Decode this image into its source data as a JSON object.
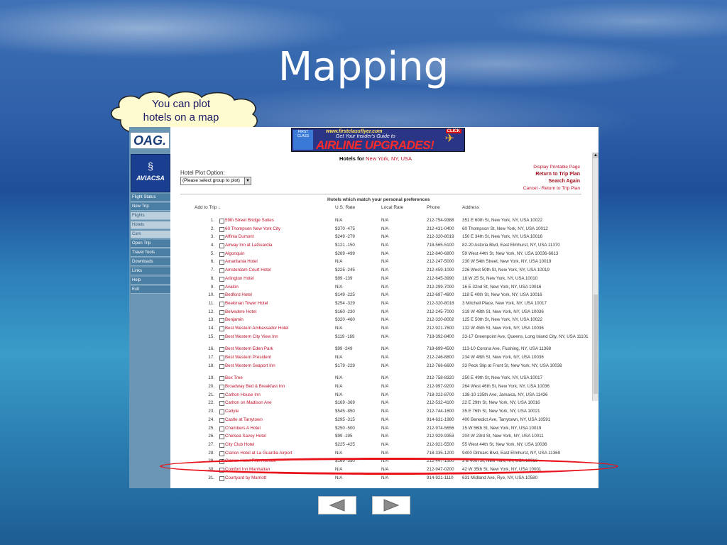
{
  "slide": {
    "title": "Mapping",
    "callout_line1": "You can plot",
    "callout_line2": "hotels on a map"
  },
  "app": {
    "logo_oag": "OAG.",
    "logo_avianca": "AVIACSA",
    "nav_items": [
      "Flight Status",
      "New Trip",
      "Flights",
      "Hotels",
      "Cars",
      "Open Trip",
      "Travel Tools",
      "Downloads",
      "Links",
      "Help",
      "Exit"
    ],
    "banner": {
      "top": "www.firstclassflyer.com",
      "mid": "Get Your Insider's Guide to",
      "main": "AIRLINE UPGRADES!",
      "click": "CLICK",
      "first_class": "FIRST CLASS"
    },
    "hotels_for_label": "Hotels for",
    "city": "New York, NY, USA",
    "links": {
      "printable": "Display Printable Page",
      "return": "Return to Trip Plan",
      "search_again": "Search Again",
      "cancel": "Cancel - Return to Trip Plan"
    },
    "plot_option_label": "Hotel Plot Option:",
    "plot_select_value": "(Please select group to plot)",
    "table_title": "Hotels which match your personal preferences",
    "columns": {
      "add": "Add to Trip ↓",
      "rate": "U.S. Rate",
      "local": "Local Rate",
      "phone": "Phone",
      "address": "Address"
    },
    "hotels": [
      {
        "n": "1.",
        "name": "59th Street Bridge Suites",
        "rate": "N/A",
        "local": "N/A",
        "phone": "212-754-9388",
        "addr": "351 E 60th St, New York, NY, USA 10022",
        "checked": false
      },
      {
        "n": "2.",
        "name": "60 Thompson New York City",
        "rate": "$370 -475",
        "local": "N/A",
        "phone": "212-431-0400",
        "addr": "60 Thompson St, New York, NY, USA 10012",
        "checked": false
      },
      {
        "n": "3.",
        "name": "Affinia Dumont",
        "rate": "$249 -279",
        "local": "N/A",
        "phone": "212-320-8019",
        "addr": "150 E 34th St, New York, NY, USA 10016",
        "checked": false
      },
      {
        "n": "4.",
        "name": "Airway Inn at LaGuardia",
        "rate": "$121 -150",
        "local": "N/A",
        "phone": "718-565-5100",
        "addr": "82-20 Astoria Blvd, East Elmhurst, NY, USA 11370",
        "checked": false
      },
      {
        "n": "5.",
        "name": "Algonquin",
        "rate": "$269 -499",
        "local": "N/A",
        "phone": "212-840-6800",
        "addr": "59 West 44th St, New York, NY, USA 10036-6613",
        "checked": false
      },
      {
        "n": "6.",
        "name": "Amaritania Hotel",
        "rate": "N/A",
        "local": "N/A",
        "phone": "212-247-5000",
        "addr": "230 W 54th Street, New York, NY, USA 10019",
        "checked": false
      },
      {
        "n": "7.",
        "name": "Amsterdam Court Hotel",
        "rate": "$225 -245",
        "local": "N/A",
        "phone": "212-459-1000",
        "addr": "226 West 50th St, New York, NY, USA 10019",
        "checked": false
      },
      {
        "n": "8.",
        "name": "Arlington Hotel",
        "rate": "$99 -139",
        "local": "N/A",
        "phone": "212-645-3990",
        "addr": "18 W 25 St, New York, NY, USA 10010",
        "checked": false
      },
      {
        "n": "9.",
        "name": "Avalon",
        "rate": "N/A",
        "local": "N/A",
        "phone": "212-299-7000",
        "addr": "16 E 32nd St, New York, NY, USA 10016",
        "checked": false
      },
      {
        "n": "10.",
        "name": "Bedford Hotel",
        "rate": "$149 -225",
        "local": "N/A",
        "phone": "212-697-4800",
        "addr": "118 E 40th St, New York, NY, USA 10016",
        "checked": false
      },
      {
        "n": "11.",
        "name": "Beekman Tower Hotel",
        "rate": "$254 -329",
        "local": "N/A",
        "phone": "212-320-8018",
        "addr": "3 Mitchell Place, New York, NY, USA 10017",
        "checked": false
      },
      {
        "n": "12.",
        "name": "Belvedere Hotel",
        "rate": "$160 -230",
        "local": "N/A",
        "phone": "212-245-7000",
        "addr": "319 W 48th St, New York, NY, USA 10036",
        "checked": false
      },
      {
        "n": "13.",
        "name": "Benjamin",
        "rate": "$320 -460",
        "local": "N/A",
        "phone": "212-320-8002",
        "addr": "125 E 50th St, New York, NY, USA 10022",
        "checked": false
      },
      {
        "n": "14.",
        "name": "Best Western Ambassador Hotel",
        "rate": "N/A",
        "local": "N/A",
        "phone": "212-921-7600",
        "addr": "132 W 45th St, New York, NY, USA 10036",
        "checked": false
      },
      {
        "n": "15.",
        "name": "Best Western City View Inn",
        "rate": "$119 -169",
        "local": "N/A",
        "phone": "718-392-8400",
        "addr": "33-17 Greenpoint Ave, Queens, Long Island City, NY, USA 11101",
        "checked": false,
        "tall": true
      },
      {
        "n": "16.",
        "name": "Best Western Eden Park",
        "rate": "$99 -249",
        "local": "N/A",
        "phone": "718-699-4500",
        "addr": "113-10 Corona Ave, Flushing, NY, USA 11368",
        "checked": false
      },
      {
        "n": "17.",
        "name": "Best Western President",
        "rate": "N/A",
        "local": "N/A",
        "phone": "212-246-8800",
        "addr": "234 W 48th St, New York, NY, USA 10036",
        "checked": false
      },
      {
        "n": "18.",
        "name": "Best Western Seaport Inn",
        "rate": "$179 -229",
        "local": "N/A",
        "phone": "212-766-6600",
        "addr": "33 Peck Slip at Front St, New York, NY, USA 10038",
        "checked": false,
        "tall": true
      },
      {
        "n": "19.",
        "name": "Box Tree",
        "rate": "N/A",
        "local": "N/A",
        "phone": "212-758-8320",
        "addr": "250 E 49th St, New York, NY, USA 10017",
        "checked": false
      },
      {
        "n": "20.",
        "name": "Broadway Bed & Breakfast Inn",
        "rate": "N/A",
        "local": "N/A",
        "phone": "212-997-9200",
        "addr": "264 West 46th St, New York, NY, USA 10036",
        "checked": false
      },
      {
        "n": "21.",
        "name": "Carlton House Inn",
        "rate": "N/A",
        "local": "N/A",
        "phone": "718-322-8700",
        "addr": "138-10 135th Ave, Jamaica, NY, USA 11436",
        "checked": false
      },
      {
        "n": "22.",
        "name": "Carlton on Madison Ave",
        "rate": "$169 -369",
        "local": "N/A",
        "phone": "212-532-4100",
        "addr": "22 E 29th St, New York, NY, USA 10016",
        "checked": false
      },
      {
        "n": "23.",
        "name": "Carlyle",
        "rate": "$545 -850",
        "local": "N/A",
        "phone": "212-744-1600",
        "addr": "35 E 76th St, New York, NY, USA 10021",
        "checked": false
      },
      {
        "n": "24.",
        "name": "Castle at Tarrytown",
        "rate": "$295 -315",
        "local": "N/A",
        "phone": "914-631-1980",
        "addr": "400 Benedict Ave, Tarrytown, NY, USA 10591",
        "checked": false
      },
      {
        "n": "25.",
        "name": "Chambers A Hotel",
        "rate": "$250 -500",
        "local": "N/A",
        "phone": "212-974-5656",
        "addr": "15 W 56th St, New York, NY, USA 10019",
        "checked": false
      },
      {
        "n": "26.",
        "name": "Chelsea Savoy Hotel",
        "rate": "$99 -195",
        "local": "N/A",
        "phone": "212-929-9353",
        "addr": "204 W 23rd St, New York, NY, USA 10011",
        "checked": false
      },
      {
        "n": "27.",
        "name": "City Club Hotel",
        "rate": "$225 -425",
        "local": "N/A",
        "phone": "212-921-5500",
        "addr": "55 West 44th St, New York, NY, USA 10036",
        "checked": false
      },
      {
        "n": "28.",
        "name": "Clarion Hotel at La Guardia Airport",
        "rate": "N/A",
        "local": "N/A",
        "phone": "718-335-1200",
        "addr": "9400 Ditmars Blvd, East Elmhurst, NY, USA 11369",
        "checked": false
      },
      {
        "n": "29.",
        "name": "Clarion Hotel Fifth Avenue",
        "rate": "$169 -350",
        "local": "N/A",
        "phone": "212-447-1500",
        "addr": "3 E 40th St, New York, NY, USA 10016",
        "checked": true
      },
      {
        "n": "30.",
        "name": "Comfort Inn Manhattan",
        "rate": "N/A",
        "local": "N/A",
        "phone": "212-947-0200",
        "addr": "42 W 35th St, New York, NY, USA 10001",
        "checked": false
      },
      {
        "n": "31.",
        "name": "Courtyard by Marriott",
        "rate": "N/A",
        "local": "N/A",
        "phone": "914-921-1110",
        "addr": "631 Midland Ave, Rye, NY, USA 10580",
        "checked": false
      }
    ]
  },
  "nav": {
    "prev_icon": "triangle-left",
    "next_icon": "triangle-right"
  }
}
